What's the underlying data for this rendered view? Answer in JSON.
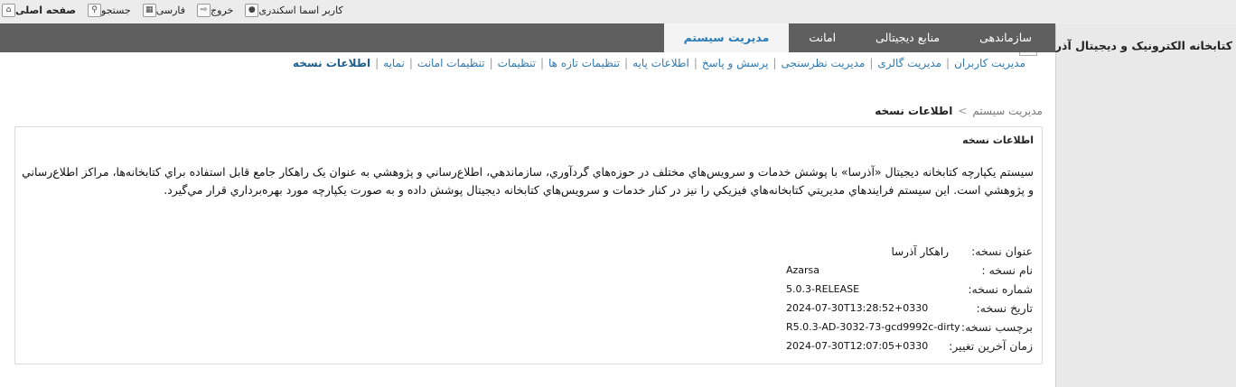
{
  "topbar": {
    "home": "صفحه اصلی",
    "search": "جستجو",
    "language": "فارسی",
    "logout": "خروج",
    "user": "کاربر اسما اسکندری"
  },
  "brand": {
    "title": "کتابخانه الکترونیک و دیجیتال آذرسا"
  },
  "tabs": [
    "سازماندهی",
    "منابع دیجیتالی",
    "امانت",
    "مدیریت سیستم"
  ],
  "active_tab": "مدیریت سیستم",
  "subnav": [
    "مدیریت کاربران",
    "مدیریت گالری",
    "مدیریت نظرسنجی",
    "پرسش و پاسخ",
    "اطلاعات پایه",
    "تنظیمات تازه ها",
    "تنظیمات",
    "تنظیمات امانت",
    "نمایه",
    "اطلاعات نسخه"
  ],
  "breadcrumb": {
    "root": "مدیریت سیستم",
    "arrow": ">",
    "current": "اطلاعات نسخه"
  },
  "panel": {
    "title": "اطلاعات نسخه",
    "description": "سيستم يکپارچه کتابخانه ديجيتال «آذرسا» با پوشش خدمات و سرويس‌هاي مختلف در حوزه‌هاي گردآوري، سازماندهي، اطلاع‌رساني و پژوهشي به عنوان يک راهکار جامع قابل استفاده براي کتابخانه‌ها، مراکز اطلاع‌رساني و پژوهشي است. اين سيستم فرايندهاي مديريتي کتابخانه‌هاي فيزيکي را نيز در کنار خدمات و سرويس‌هاي کتابخانه ديجيتال پوشش داده و به صورت يکپارچه مورد بهره‌برداري قرار مي‌گيرد.",
    "fields": [
      {
        "label": "عنوان نسخه:",
        "value": "راهکار آذرسا"
      },
      {
        "label": "نام نسخه :",
        "value": "Azarsa"
      },
      {
        "label": "شماره نسخه:",
        "value": "5.0.3-RELEASE"
      },
      {
        "label": "تاریخ نسخه:",
        "value": "2024-07-30T13:28:52+0330"
      },
      {
        "label": "برچسب نسخه:",
        "value": "R5.0.3-AD-3032-73-gcd9992c-dirty"
      },
      {
        "label": "زمان آخرین تغییر:",
        "value": "2024-07-30T12:07:05+0330"
      }
    ]
  },
  "icons": {
    "home": "home-icon",
    "search": "search-icon",
    "language": "keyboard-icon",
    "logout": "logout-icon",
    "user": "user-icon",
    "logo": "document-logo"
  },
  "colors": {
    "navbar": "#5f5f5f",
    "active_tab_text": "#2a7ab8",
    "link": "#2f79b0"
  }
}
